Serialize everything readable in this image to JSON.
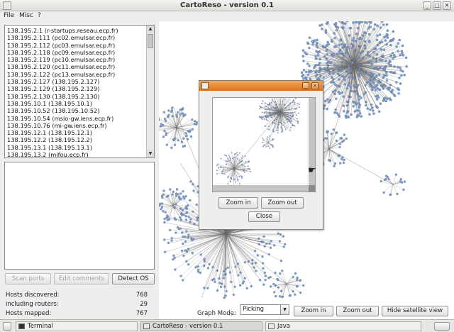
{
  "window": {
    "title": "CartoReso - version 0.1",
    "min": "_",
    "max": "□",
    "close": "✕"
  },
  "menu": [
    "File",
    "Misc",
    "?"
  ],
  "hosts": [
    "138.195.2.1 (r-startups.reseau.ecp.fr)",
    "138.195.2.111 (pc02.emulsar.ecp.fr)",
    "138.195.2.112 (pc03.emulsar.ecp.fr)",
    "138.195.2.118 (pc09.emulsar.ecp.fr)",
    "138.195.2.119 (pc10.emulsar.ecp.fr)",
    "138.195.2.120 (pc11.emulsar.ecp.fr)",
    "138.195.2.122 (pc13.emulsar.ecp.fr)",
    "138.195.2.127 (138.195.2.127)",
    "138.195.2.129 (138.195.2.129)",
    "138.195.2.130 (138.195.2.130)",
    "138.195.10.1 (138.195.10.1)",
    "138.195.10.52 (138.195.10.52)",
    "138.195.10.54 (msio-gw.iens.ecp.fr)",
    "138.195.10.76 (mi-gw.iens.ecp.fr)",
    "138.195.12.1 (138.195.12.1)",
    "138.195.12.2 (138.195.12.2)",
    "138.195.13.1 (138.195.13.1)",
    "138.195.13.2 (mifou.ecp.fr)"
  ],
  "buttons": {
    "scan_ports": "Scan ports",
    "edit_comments": "Edit comments",
    "detect_os": "Detect OS"
  },
  "stats": [
    {
      "label": "Hosts discovered:",
      "value": "768"
    },
    {
      "label": "including routers:",
      "value": "29"
    },
    {
      "label": "Hosts mapped:",
      "value": "767"
    }
  ],
  "graph_controls": {
    "mode_label": "Graph Mode:",
    "mode_value": "Picking",
    "zoom_in": "Zoom in",
    "zoom_out": "Zoom out",
    "hide_satellite": "Hide satellite view"
  },
  "satellite": {
    "zoom_in": "Zoom in",
    "zoom_out": "Zoom out",
    "close": "Close"
  },
  "taskbar": [
    {
      "label": "Terminal"
    },
    {
      "label": "CartoReso - version 0.1"
    },
    {
      "label": "Java"
    }
  ],
  "colors": {
    "node": "#7f9ec9",
    "edge": "#6a6a6a",
    "sat_title": "#e08a35"
  }
}
